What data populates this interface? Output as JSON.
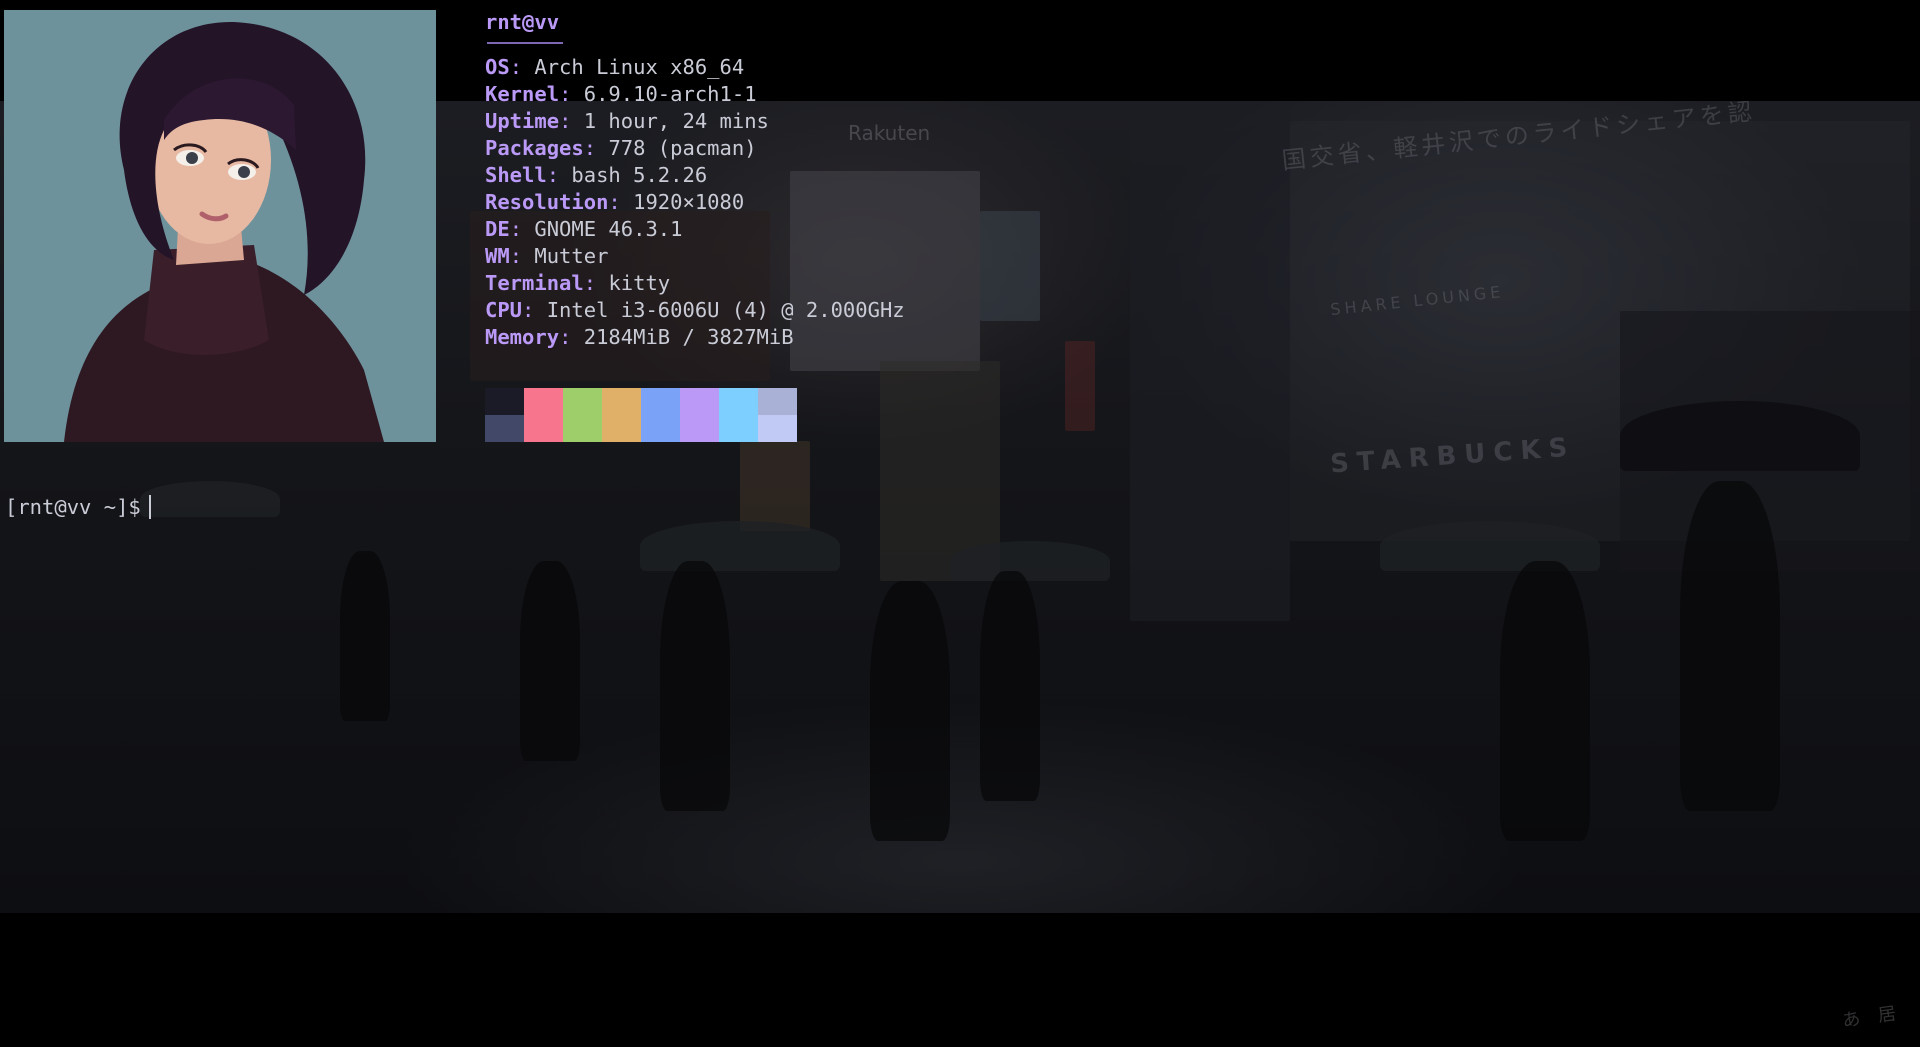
{
  "fetch": {
    "userhost": "rnt@vv",
    "rows": [
      {
        "key": "OS",
        "value": "Arch Linux x86_64"
      },
      {
        "key": "Kernel",
        "value": "6.9.10-arch1-1"
      },
      {
        "key": "Uptime",
        "value": "1 hour, 24 mins"
      },
      {
        "key": "Packages",
        "value": "778 (pacman)"
      },
      {
        "key": "Shell",
        "value": "bash 5.2.26"
      },
      {
        "key": "Resolution",
        "value": "1920×1080"
      },
      {
        "key": "DE",
        "value": "GNOME 46.3.1"
      },
      {
        "key": "WM",
        "value": "Mutter"
      },
      {
        "key": "Terminal",
        "value": "kitty"
      },
      {
        "key": "CPU",
        "value": "Intel i3-6006U (4) @ 2.000GHz"
      },
      {
        "key": "Memory",
        "value": "2184MiB / 3827MiB"
      }
    ]
  },
  "palette": {
    "top": [
      "#1a1b26",
      "#f7768e",
      "#9ece6a",
      "#e0af68",
      "#7aa2f7",
      "#bb9af7",
      "#7dcfff",
      "#a9b1d6"
    ],
    "bottom": [
      "#414868",
      "#f7768e",
      "#9ece6a",
      "#e0af68",
      "#7aa2f7",
      "#bb9af7",
      "#7dcfff",
      "#c0caf5"
    ]
  },
  "prompt": {
    "text": "[rnt@vv ~]$"
  },
  "wallpaper": {
    "sign_rakuten": "Rakuten",
    "sign_starbucks": "STARBUCKS",
    "sign_japanese": "国交省、軽井沢でのライドシェアを認",
    "sign_lounge": "SHARE LOUNGE",
    "watermark": "あ　居"
  },
  "colors": {
    "accent": "#bb9af7",
    "text": "#c9cbd6",
    "avatar_bg": "#6e929b"
  }
}
